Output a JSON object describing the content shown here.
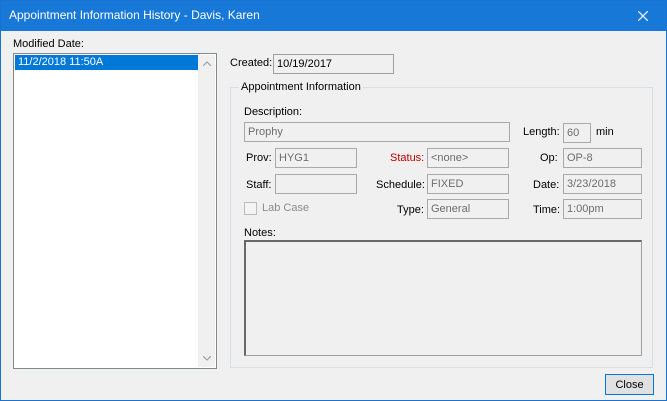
{
  "window": {
    "title": "Appointment Information History - Davis, Karen"
  },
  "modified": {
    "label": "Modified Date:",
    "items": [
      "11/2/2018   11:50A"
    ]
  },
  "created": {
    "label": "Created:",
    "value": "10/19/2017"
  },
  "appt": {
    "group_title": "Appointment Information",
    "description_label": "Description:",
    "description_value": "Prophy",
    "length_label": "Length:",
    "length_value": "60",
    "length_unit": "min",
    "prov_label": "Prov:",
    "prov_value": "HYG1",
    "status_label": "Status:",
    "status_value": "<none>",
    "op_label": "Op:",
    "op_value": "OP-8",
    "staff_label": "Staff:",
    "staff_value": "",
    "schedule_label": "Schedule:",
    "schedule_value": "FIXED",
    "date_label": "Date:",
    "date_value": "3/23/2018",
    "labcase_label": "Lab Case",
    "type_label": "Type:",
    "type_value": "General",
    "time_label": "Time:",
    "time_value": "1:00pm",
    "notes_label": "Notes:",
    "notes_value": ""
  },
  "buttons": {
    "close_label": "Close"
  },
  "colors": {
    "titlebar": "#1778d8",
    "selection": "#0078d7",
    "status_label": "#c00000"
  },
  "icons": {
    "title_close": "close-icon",
    "scroll_up": "chevron-up-icon",
    "scroll_down": "chevron-down-icon"
  }
}
